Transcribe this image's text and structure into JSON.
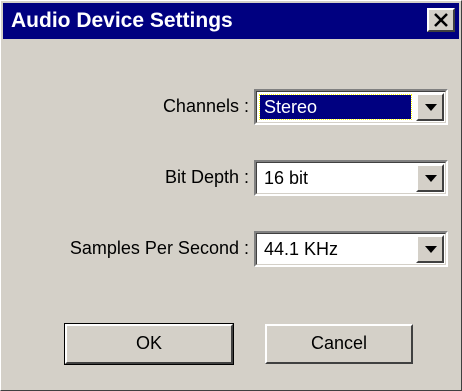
{
  "window": {
    "title": "Audio Device Settings",
    "close_icon": "close-icon"
  },
  "fields": {
    "channels": {
      "label": "Channels :",
      "value": "Stereo"
    },
    "bit_depth": {
      "label": "Bit Depth :",
      "value": "16 bit"
    },
    "samples_per_second": {
      "label": "Samples Per Second :",
      "value": "44.1 KHz"
    }
  },
  "buttons": {
    "ok_label": "OK",
    "cancel_label": "Cancel"
  },
  "colors": {
    "titlebar": "#000080",
    "face": "#d4d0c8",
    "selection": "#000080"
  }
}
